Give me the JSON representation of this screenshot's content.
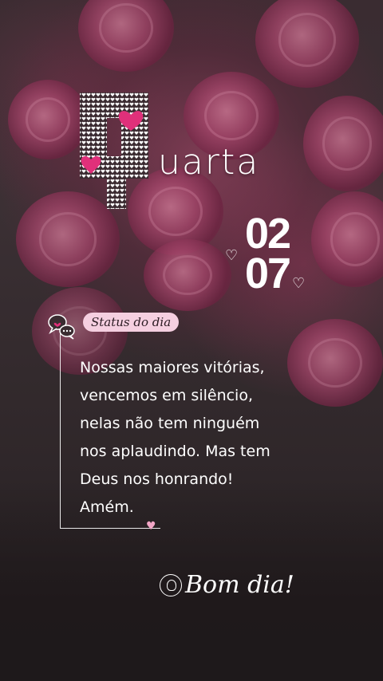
{
  "title": {
    "first_letter": "Q",
    "rest": "uarta"
  },
  "date": {
    "day": "02",
    "month": "07"
  },
  "status": {
    "badge_label": "Status do dia",
    "message_lines": [
      "Nossas maiores vitórias,",
      "vencemos em silêncio,",
      "nelas não tem ninguém",
      "nos aplaudindo. Mas tem",
      "Deus nos honrando!",
      "Amém."
    ]
  },
  "signature": {
    "text": "Bom dia!"
  },
  "icons": {
    "chat": "chat-bubbles-icon",
    "heart": "heart-icon",
    "flower": "flower-icon"
  },
  "colors": {
    "accent_pink": "#e0307a",
    "badge_bg": "#f5cfe0",
    "text": "#ffffff"
  }
}
